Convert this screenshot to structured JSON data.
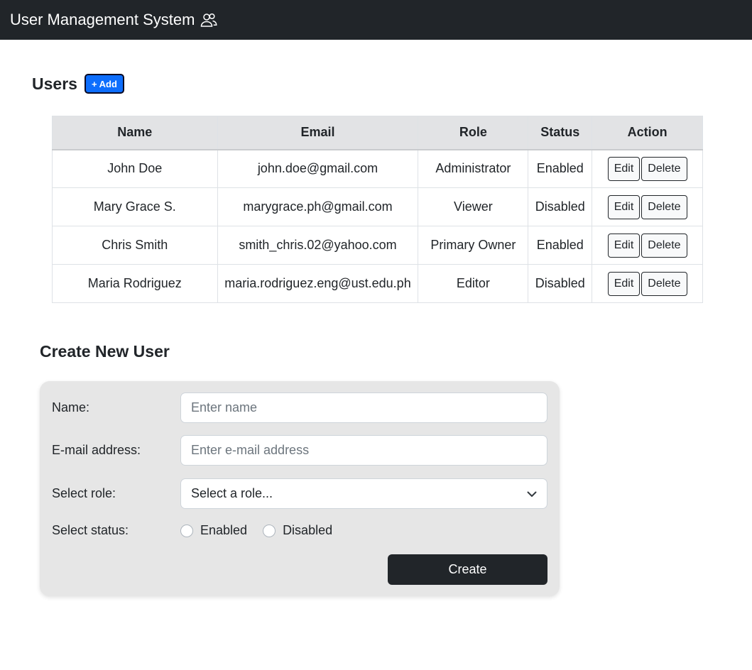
{
  "header": {
    "title": "User Management System",
    "icon": "users-icon"
  },
  "users_section": {
    "title": "Users",
    "add_label": "+ Add"
  },
  "table": {
    "columns": [
      "Name",
      "Email",
      "Role",
      "Status",
      "Action"
    ],
    "rows": [
      {
        "name": "John Doe",
        "email": "john.doe@gmail.com",
        "role": "Administrator",
        "status": "Enabled"
      },
      {
        "name": "Mary Grace S.",
        "email": "marygrace.ph@gmail.com",
        "role": "Viewer",
        "status": "Disabled"
      },
      {
        "name": "Chris Smith",
        "email": "smith_chris.02@yahoo.com",
        "role": "Primary Owner",
        "status": "Enabled"
      },
      {
        "name": "Maria Rodriguez",
        "email": "maria.rodriguez.eng@ust.edu.ph",
        "role": "Editor",
        "status": "Disabled"
      }
    ],
    "edit_label": "Edit",
    "delete_label": "Delete"
  },
  "create_form": {
    "title": "Create New User",
    "name_label": "Name:",
    "name_value": "",
    "name_placeholder": "Enter name",
    "email_label": "E-mail address:",
    "email_value": "",
    "email_placeholder": "Enter e-mail address",
    "role_label": "Select role:",
    "role_selected": "Select a role...",
    "status_label": "Select status:",
    "status_options": [
      "Enabled",
      "Disabled"
    ],
    "submit_label": "Create"
  },
  "colors": {
    "navbar": "#212529",
    "primary": "#0d6efd",
    "table_header": "#e2e3e5",
    "form_card": "#e6e6e6"
  }
}
